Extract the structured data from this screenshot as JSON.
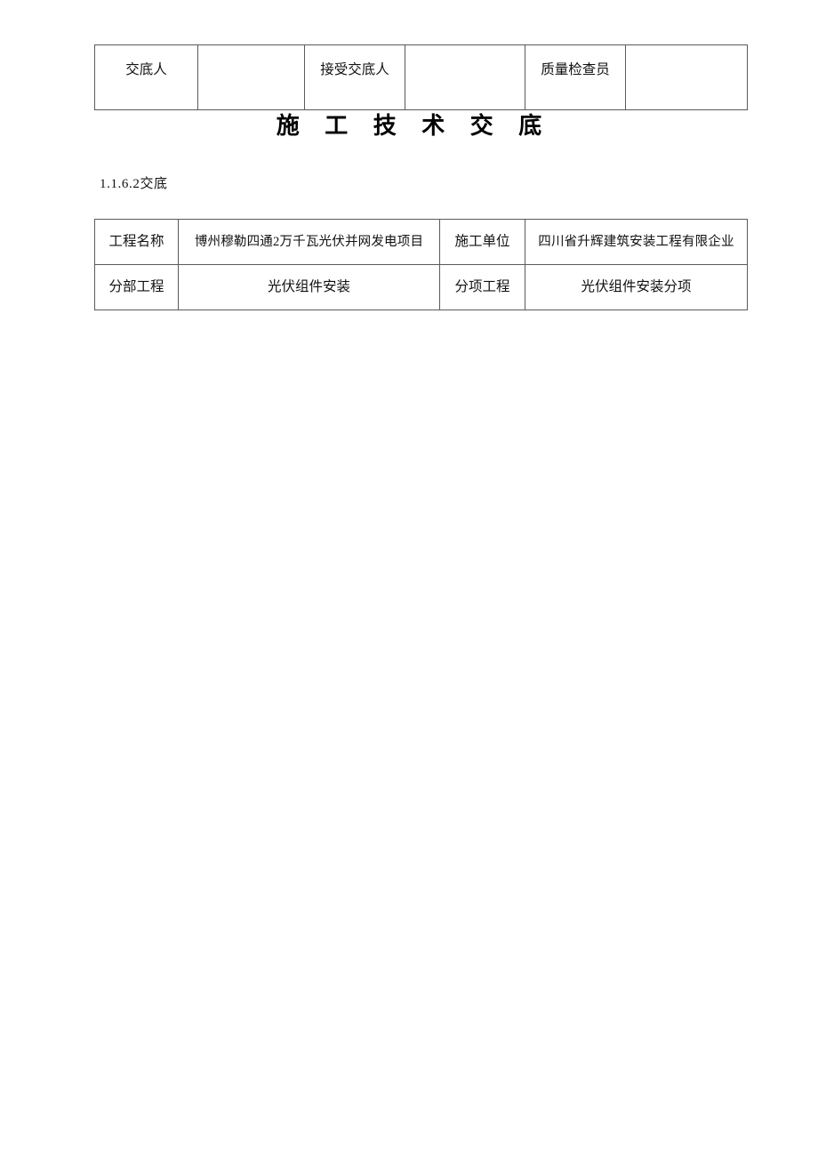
{
  "document": {
    "title": "施 工 技 术 交 底",
    "section_label": "1.1.6.2交底"
  },
  "signature_table": {
    "cells": [
      {
        "text": "交底人",
        "kind": "label"
      },
      {
        "text": "",
        "kind": "blank"
      },
      {
        "text": "接受交底人",
        "kind": "label"
      },
      {
        "text": "",
        "kind": "blank"
      },
      {
        "text": "质量检查员",
        "kind": "label"
      },
      {
        "text": "",
        "kind": "blank"
      }
    ]
  },
  "project_table": {
    "rows": [
      {
        "label_left": "工程名称",
        "value_left": "博州穆勒四通2万千瓦光伏并网发电项目",
        "label_right": "施工单位",
        "value_right": "四川省升辉建筑安装工程有限企业"
      },
      {
        "label_left": "分部工程",
        "value_left": "光伏组件安装",
        "label_right": "分项工程",
        "value_right": "光伏组件安装分项"
      }
    ]
  },
  "theme": {
    "page_background": "#ffffff",
    "text_color": "#111111",
    "border_color": "#5a5a5a"
  }
}
